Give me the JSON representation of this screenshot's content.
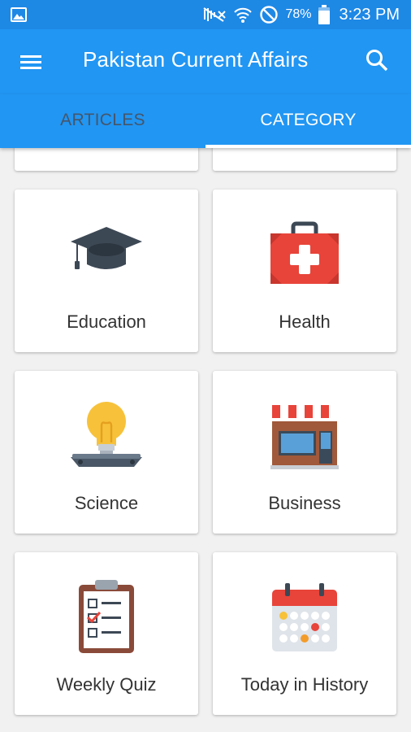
{
  "status": {
    "battery": "78%",
    "time": "3:23 PM"
  },
  "app": {
    "title": "Pakistan Current Affairs"
  },
  "tabs": [
    {
      "label": "ARTICLES",
      "active": false
    },
    {
      "label": "CATEGORY",
      "active": true
    }
  ],
  "categories": [
    {
      "label": "Education",
      "icon": "graduation-cap-icon"
    },
    {
      "label": "Health",
      "icon": "first-aid-kit-icon"
    },
    {
      "label": "Science",
      "icon": "light-bulb-icon"
    },
    {
      "label": "Business",
      "icon": "storefront-icon"
    },
    {
      "label": "Weekly Quiz",
      "icon": "clipboard-checklist-icon"
    },
    {
      "label": "Today in History",
      "icon": "calendar-icon"
    }
  ],
  "colors": {
    "primary": "#2196f3",
    "status_bar": "#1e88e5",
    "inactive_tab": "#45566b",
    "background": "#f1f1f1"
  }
}
